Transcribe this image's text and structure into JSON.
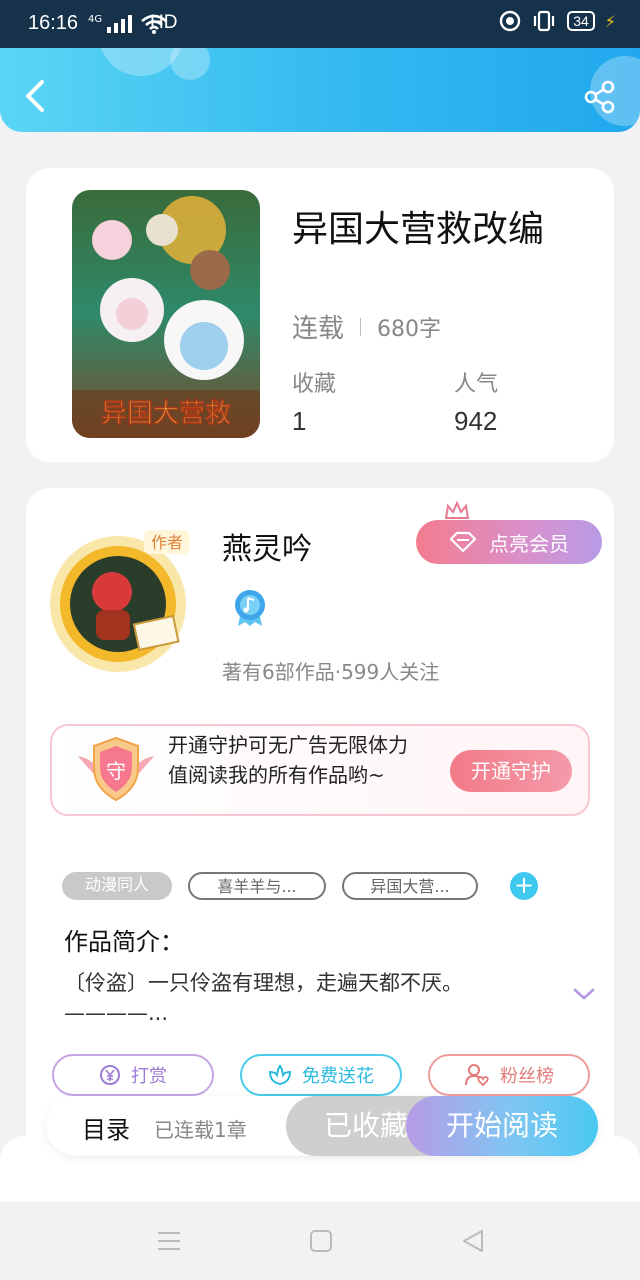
{
  "status_bar": {
    "time": "16:16",
    "network": "4G",
    "hd": "HD",
    "battery": "34"
  },
  "header": {
    "back_icon": "chevron-left-icon",
    "share_icon": "share-icon",
    "gradient": [
      "#5ad5f4",
      "#21a8ee"
    ]
  },
  "book": {
    "title": "异国大营救改编",
    "status": "连载",
    "word_count": "680字",
    "favorites_label": "收藏",
    "favorites_value": "1",
    "popularity_label": "人气",
    "popularity_value": "942"
  },
  "author": {
    "name": "燕灵吟",
    "meta": "著有6部作品·599人关注",
    "avatar_tag": "作者",
    "vip_button": "点亮会员"
  },
  "guard": {
    "badge": "守",
    "text": "开通守护可无广告无限体力值阅读我的所有作品哟~",
    "button": "开通守护"
  },
  "tags": [
    "动漫同人",
    "喜羊羊与...",
    "异国大营..."
  ],
  "intro": {
    "title": "作品简介：",
    "text": "〔伶盗〕一只伶盗有理想，走遍天都不厌。————..."
  },
  "actions": {
    "tip": "打赏",
    "flower": "免费送花",
    "fans": "粉丝榜"
  },
  "bottom_bar": {
    "toc": "目录",
    "chapters": "已连载1章",
    "collect": "已收藏",
    "read": "开始阅读"
  },
  "colors": {
    "accent_blue": "#33b9f0",
    "pink": "#f27a86",
    "purple": "#b79be6"
  }
}
